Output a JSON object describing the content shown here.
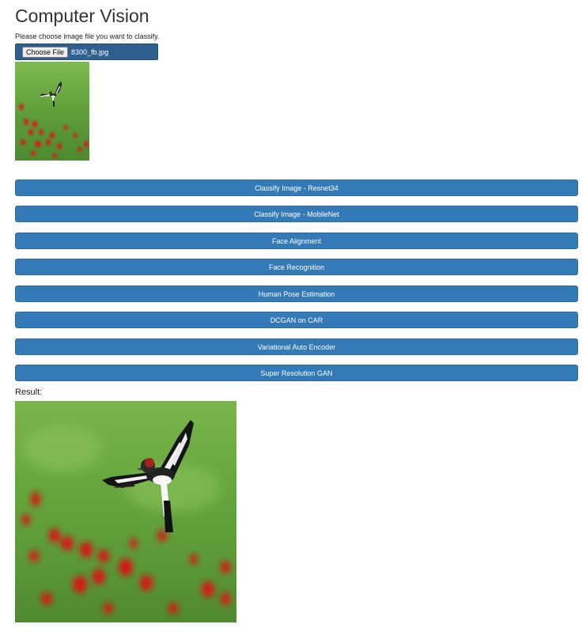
{
  "page": {
    "title": "Computer Vision",
    "instructions": "Please choose image file you want to classify."
  },
  "upload": {
    "button_label": "Choose File",
    "file_name": "8300_fb.jpg"
  },
  "actions": [
    "Classify Image - Resnet34",
    "Classify Image - MobileNet",
    "Face Alignment",
    "Face Recognition",
    "Human Pose Estimation",
    "DCGAN on CAR",
    "Variational Auto Encoder",
    "Super Resolution GAN"
  ],
  "result": {
    "label": "Result:"
  },
  "colors": {
    "button_primary": "#337ab7",
    "file_bar": "#2e5f8e",
    "photo_background": "#6aa843",
    "poppy_red": "#d81a1a"
  }
}
